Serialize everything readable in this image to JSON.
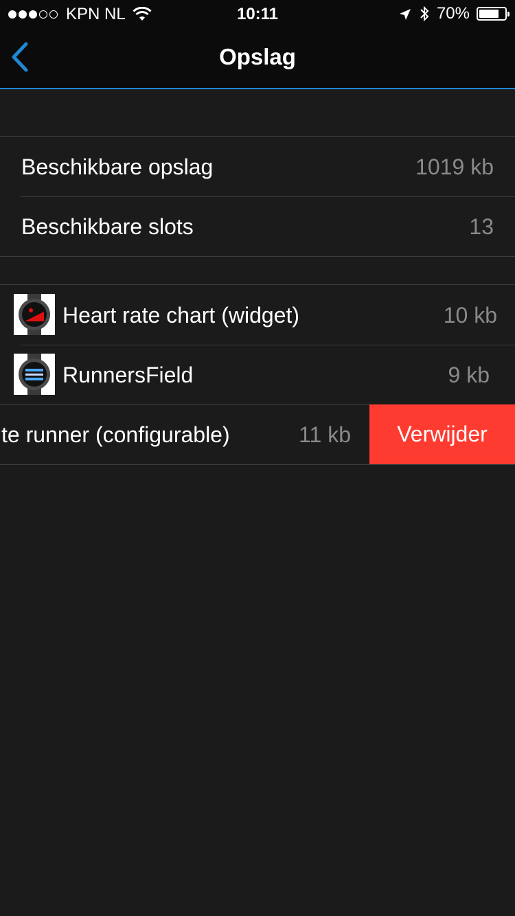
{
  "status_bar": {
    "carrier": "KPN NL",
    "time": "10:11",
    "battery": "70%",
    "battery_level": 0.7,
    "signal_bars": 3,
    "signal_total": 5
  },
  "nav": {
    "title": "Opslag",
    "accent_color": "#1e88d4"
  },
  "storage": {
    "items": [
      {
        "label": "Beschikbare opslag",
        "value": "1019 kb"
      },
      {
        "label": "Beschikbare slots",
        "value": "13"
      }
    ]
  },
  "apps": {
    "items": [
      {
        "label": "Heart rate chart (widget)",
        "value": "10 kb",
        "icon": "watch-icon"
      },
      {
        "label": "RunnersField",
        "value": "9 kb",
        "icon": "watch-icon"
      },
      {
        "label": "te runner (configurable)",
        "value": "11 kb",
        "delete_label": "Verwijder",
        "delete_color": "#fe3b30"
      }
    ]
  }
}
